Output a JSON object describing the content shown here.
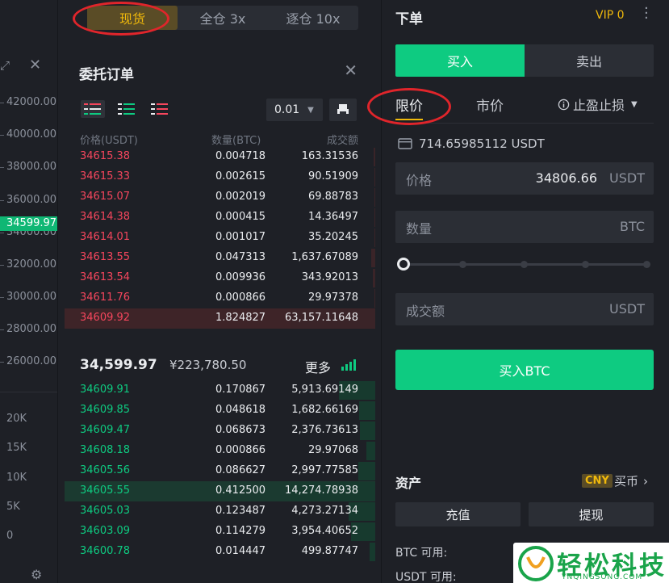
{
  "mode_tabs": [
    {
      "label": "现货",
      "active": true
    },
    {
      "label": "全仓 3x",
      "active": false
    },
    {
      "label": "逐仓 10x",
      "active": false
    }
  ],
  "price_axis": {
    "labels": [
      "42000.00",
      "40000.00",
      "38000.00",
      "36000.00",
      "34000.00",
      "32000.00",
      "30000.00",
      "28000.00",
      "26000.00"
    ],
    "current_price_tag": "34599.97",
    "volume_labels": [
      "20K",
      "15K",
      "10K",
      "5K",
      "0"
    ]
  },
  "orderbook": {
    "title": "委托订单",
    "precision": "0.01",
    "headers": {
      "price": "价格(USDT)",
      "amount": "数量(BTC)",
      "total": "成交额"
    },
    "asks": [
      {
        "price": "34615.38",
        "amount": "0.004718",
        "total": "163.31536",
        "depth": 0.02
      },
      {
        "price": "34615.33",
        "amount": "0.002615",
        "total": "90.51909",
        "depth": 0.01
      },
      {
        "price": "34615.07",
        "amount": "0.002019",
        "total": "69.88783",
        "depth": 0.01
      },
      {
        "price": "34614.38",
        "amount": "0.000415",
        "total": "14.36497",
        "depth": 0.005
      },
      {
        "price": "34614.01",
        "amount": "0.001017",
        "total": "35.20245",
        "depth": 0.006
      },
      {
        "price": "34613.55",
        "amount": "0.047313",
        "total": "1,637.67089",
        "depth": 0.05
      },
      {
        "price": "34613.54",
        "amount": "0.009936",
        "total": "343.92013",
        "depth": 0.03
      },
      {
        "price": "34611.76",
        "amount": "0.000866",
        "total": "29.97378",
        "depth": 0.005
      },
      {
        "price": "34609.92",
        "amount": "1.824827",
        "total": "63,157.11648",
        "depth": 1.0
      }
    ],
    "mid_price": "34,599.97",
    "mid_cny": "¥223,780.50",
    "more_label": "更多",
    "bids": [
      {
        "price": "34609.91",
        "amount": "0.170867",
        "total": "5,913.69149",
        "depth": 0.43
      },
      {
        "price": "34609.85",
        "amount": "0.048618",
        "total": "1,682.66169",
        "depth": 0.19
      },
      {
        "price": "34609.47",
        "amount": "0.068673",
        "total": "2,376.73613",
        "depth": 0.18
      },
      {
        "price": "34608.18",
        "amount": "0.000866",
        "total": "29.97068",
        "depth": 0.1
      },
      {
        "price": "34605.56",
        "amount": "0.086627",
        "total": "2,997.77585",
        "depth": 0.2
      },
      {
        "price": "34605.55",
        "amount": "0.412500",
        "total": "14,274.78938",
        "depth": 1.0
      },
      {
        "price": "34605.03",
        "amount": "0.123487",
        "total": "4,273.27134",
        "depth": 0.31
      },
      {
        "price": "34603.09",
        "amount": "0.114279",
        "total": "3,954.40652",
        "depth": 0.29
      },
      {
        "price": "34600.78",
        "amount": "0.014447",
        "total": "499.87747",
        "depth": 0.07
      }
    ]
  },
  "order_panel": {
    "title": "下单",
    "vip": "VIP 0",
    "side_tabs": {
      "buy": "买入",
      "sell": "卖出"
    },
    "order_types": {
      "limit": "限价",
      "market": "市价",
      "stop": "止盈止损"
    },
    "balance": "714.65985112 USDT",
    "price_field": {
      "label": "价格",
      "value": "34806.66",
      "unit": "USDT"
    },
    "amount_field": {
      "label": "数量",
      "unit": "BTC"
    },
    "total_field": {
      "label": "成交额",
      "unit": "USDT"
    },
    "submit": "买入BTC",
    "assets": {
      "title": "资产",
      "currency_badge": "CNY",
      "buy_coin": "买币",
      "deposit": "充值",
      "withdraw": "提现",
      "btc_available": "BTC 可用:",
      "usdt_available": "USDT 可用:"
    }
  },
  "watermark": {
    "text": "轻松科技",
    "url": "YNQINGSONG.COM"
  },
  "colors": {
    "buy": "#0ecb81",
    "sell": "#f6465d",
    "accent": "#f0b90b",
    "highlight_ring": "#e0252b"
  }
}
